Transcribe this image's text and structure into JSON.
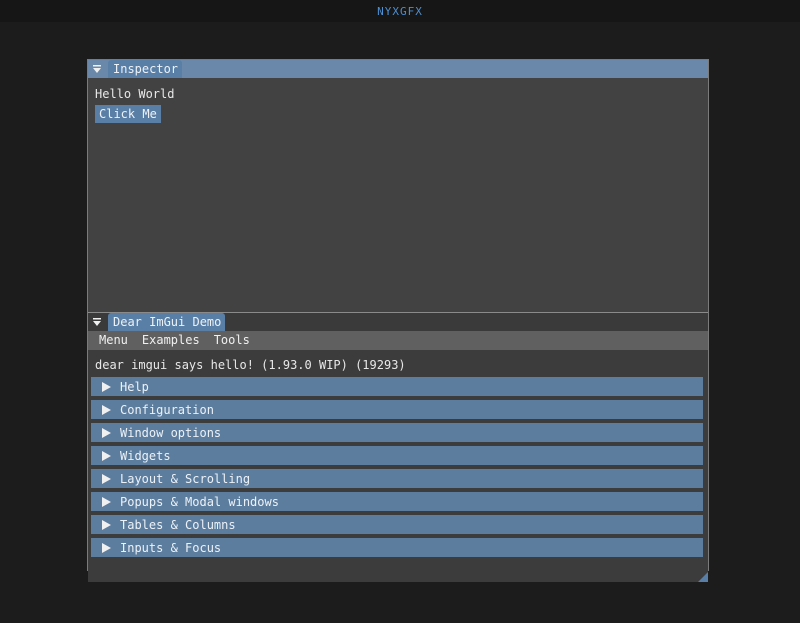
{
  "app": {
    "title": "NYXGFX"
  },
  "inspector": {
    "tab_label": "Inspector",
    "text": "Hello World",
    "button_label": "Click Me"
  },
  "demo": {
    "tab_label": "Dear ImGui Demo",
    "menu": [
      "Menu",
      "Examples",
      "Tools"
    ],
    "hello_text": "dear imgui says hello! (1.93.0 WIP) (19293)",
    "headers": [
      "Help",
      "Configuration",
      "Window options",
      "Widgets",
      "Layout & Scrolling",
      "Popups & Modal windows",
      "Tables & Columns",
      "Inputs & Focus"
    ]
  },
  "colors": {
    "accent": "#5a7fa6",
    "title_blue": "#4d8fd1",
    "background": "#1c1c1c",
    "panel": "#424242"
  }
}
